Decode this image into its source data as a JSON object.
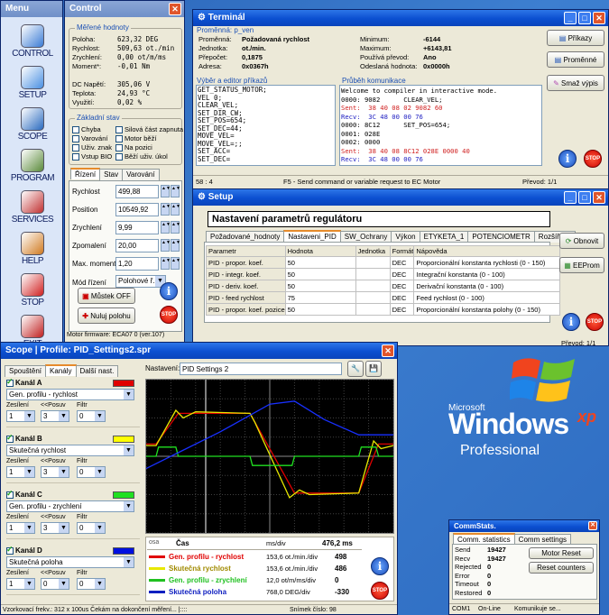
{
  "menu": {
    "title": "Menu",
    "items": [
      {
        "label": "CONTROL",
        "icon": "control-icon"
      },
      {
        "label": "SETUP",
        "icon": "setup-icon"
      },
      {
        "label": "SCOPE",
        "icon": "scope-icon"
      },
      {
        "label": "PROGRAM",
        "icon": "program-icon"
      },
      {
        "label": "SERVICES",
        "icon": "services-icon"
      },
      {
        "label": "HELP",
        "icon": "help-icon"
      },
      {
        "label": "STOP",
        "icon": "stop-icon"
      },
      {
        "label": "EXIT",
        "icon": "exit-icon"
      }
    ]
  },
  "control": {
    "title": "Control",
    "measured_title": "Měřené hodnoty",
    "measured": [
      {
        "label": "Poloha:",
        "value": "623,32 DEG"
      },
      {
        "label": "Rychlost:",
        "value": "509,63 ot./min"
      },
      {
        "label": "Zrychlení:",
        "value": "0,00 ot/m/ms"
      },
      {
        "label": "Moment*:",
        "value": "-0,01 Nm"
      }
    ],
    "measured2": [
      {
        "label": "DC Napětí:",
        "value": "305,06 V"
      },
      {
        "label": "Teplota:",
        "value": "24,93 °C"
      },
      {
        "label": "Využití:",
        "value": "0,02 %"
      }
    ],
    "status_title": "Základní stav",
    "status": [
      [
        "Chyba",
        "Silová část zapnuta"
      ],
      [
        "Varování",
        "Motor běží"
      ],
      [
        "Uživ. znak",
        "Na pozici"
      ],
      [
        "Vstup BIO",
        "Běží uživ. úkol"
      ]
    ],
    "tabs": [
      "Řízení",
      "Stav",
      "Varování"
    ],
    "params": [
      {
        "label": "Rychlost",
        "value": "499,88"
      },
      {
        "label": "Position",
        "value": "10549,92"
      },
      {
        "label": "Zrychlení",
        "value": "9,99"
      },
      {
        "label": "Zpomalení",
        "value": "20,00"
      },
      {
        "label": "Max. moment",
        "value": "1,20"
      }
    ],
    "mode_label": "Mód řízení",
    "mode_value": "Polohové ř.",
    "bridge_btn": "Můstek OFF",
    "zero_btn": "Nuluj polohu",
    "firmware": "Motor firmware: ECA07 0 (ver.107)"
  },
  "terminal": {
    "title": "Terminál",
    "var_title": "Proměnná: p_ven",
    "var_left": [
      {
        "label": "Proměnná:",
        "value": "Požadovaná rychlost"
      },
      {
        "label": "Jednotka:",
        "value": "ot./min."
      },
      {
        "label": "Přepočet:",
        "value": "0,1875"
      },
      {
        "label": "Adresa:",
        "value": "0x0367h"
      }
    ],
    "var_right": [
      {
        "label": "Minimum:",
        "value": "-6144"
      },
      {
        "label": "Maximum:",
        "value": "+6143,81"
      },
      {
        "label": "Používá převod:",
        "value": "Ano"
      },
      {
        "label": "Odeslaná hodnota:",
        "value": "0x0000h"
      }
    ],
    "cmd_title": "Výběr a editor příkazů",
    "commands": [
      "GET_STATUS_MOTOR;",
      "VEL 0;",
      "CLEAR_VEL;",
      "SET_DIR_CW;",
      "SET_POS=654;",
      "SET_DEC=44;",
      "MOVE_VEL=",
      "MOVE_VEL=;;",
      "SET_ACC=",
      "SET_DEC="
    ],
    "comm_title": "Průběh komunikace",
    "comm": [
      {
        "text": "Welcome to compiler in interactive mode.",
        "kind": "plain"
      },
      {
        "text": "0000: 9082      CLEAR_VEL;",
        "kind": "plain"
      },
      {
        "text": "Sent:  38 40 08 02 9082 60",
        "kind": "sent"
      },
      {
        "text": "Recv:  3C 48 00 00 76",
        "kind": "recv"
      },
      {
        "text": "0000: 8C12      SET_POS=654;",
        "kind": "plain"
      },
      {
        "text": "0001: 028E",
        "kind": "plain"
      },
      {
        "text": "0002: 0000",
        "kind": "plain"
      },
      {
        "text": "Sent:  38 40 08 8C12 028E 0000 40",
        "kind": "sent"
      },
      {
        "text": "Recv:  3C 48 00 00 76",
        "kind": "recv"
      }
    ],
    "buttons": [
      "Příkazy",
      "Proměnné",
      "Smaž výpis"
    ],
    "status_left": "58 : 4",
    "status_mid": "F5 - Send command or variable request to EC Motor",
    "status_right": "Převod: 1/1"
  },
  "setup": {
    "title": "Setup",
    "heading": "Nastavení parametrů regulátoru",
    "tabs": [
      "Požadované_hodnoty",
      "Nastaveni_PID",
      "SW_Ochrany",
      "Výkon",
      "ETYKETA_1",
      "POTENCIOMETR",
      "Rozšířené"
    ],
    "columns": [
      "Parametr",
      "Hodnota",
      "Jednotka",
      "Formát",
      "Nápověda"
    ],
    "rows": [
      [
        "PID - propor. koef.",
        "50",
        "",
        "DEC",
        "Proporcionální konstanta rychlosti (0 - 150)"
      ],
      [
        "PID - integr. koef.",
        "50",
        "",
        "DEC",
        "Integrační konstanta (0 - 100)"
      ],
      [
        "PID - deriv. koef.",
        "50",
        "",
        "DEC",
        "Derivační konstanta (0 - 100)"
      ],
      [
        "PID - feed rychlost",
        "75",
        "",
        "DEC",
        "Feed rychlost (0 - 100)"
      ],
      [
        "PID - propor. koef. pozice",
        "50",
        "",
        "DEC",
        "Proporcionální konstanta polohy (0 - 150)"
      ]
    ],
    "buttons": [
      "Obnovit",
      "EEProm"
    ],
    "status_right": "Převod: 1/1"
  },
  "scope": {
    "title": "Scope | Profile: PID_Settings2.spr",
    "tabs": [
      "Spouštění",
      "Kanály",
      "Další nast."
    ],
    "setting_label": "Nastavení:",
    "setting_value": "PID Settings 2",
    "channels": [
      {
        "name": "Kanál A",
        "signal": "Gen. profilu - rychlost",
        "color": "#e00000",
        "gain": "1",
        "shift": "3",
        "filter": "0"
      },
      {
        "name": "Kanál B",
        "signal": "Skutečná rychlost",
        "color": "#ffff00",
        "gain": "1",
        "shift": "3",
        "filter": "0"
      },
      {
        "name": "Kanál C",
        "signal": "Gen. profilu - zrychlení",
        "color": "#20e020",
        "gain": "1",
        "shift": "3",
        "filter": "0"
      },
      {
        "name": "Kanál D",
        "signal": "Skutečná poloha",
        "color": "#0010e0",
        "gain": "1",
        "shift": "0",
        "filter": "0"
      }
    ],
    "ch_labels": {
      "gain": "Zesílení",
      "shift": "<<Posuv",
      "filter": "Filtr"
    },
    "legend_header": {
      "axis": "osa",
      "time": "Čas",
      "unit": "ms/div",
      "value": "476,2 ms"
    },
    "legend": [
      {
        "name": "Gen. profilu - rychlost",
        "scale": "153,6 ot./min./div",
        "value": "498",
        "color": "#e00000"
      },
      {
        "name": "Skutečná rychlost",
        "scale": "153,6 ot./min./div",
        "value": "486",
        "color": "#e8e800"
      },
      {
        "name": "Gen. profilu - zrychlení",
        "scale": "12,0 ot/m/ms/div",
        "value": "0",
        "color": "#20c020"
      },
      {
        "name": "Skutečná poloha",
        "scale": "768,0 DEG/div",
        "value": "-330",
        "color": "#1020c0"
      }
    ],
    "status": "Vzorkovací frekv.: 312 x 100us    Čekám na dokončení měření... |::::",
    "frame": "Snímek číslo: 98"
  },
  "comm": {
    "title": "CommStats.",
    "tabs": [
      "Comm. statistics",
      "Comm settings"
    ],
    "stats": [
      {
        "label": "Send",
        "value": "19427"
      },
      {
        "label": "Recv",
        "value": "19427"
      },
      {
        "label": "Rejected",
        "value": "0"
      },
      {
        "label": "Error",
        "value": "0"
      },
      {
        "label": "Timeout",
        "value": "0"
      },
      {
        "label": "Restored",
        "value": "0"
      }
    ],
    "buttons": [
      "Motor Reset",
      "Reset counters"
    ],
    "status": [
      "COM1",
      "On-Line",
      "Komunikuje se..."
    ]
  },
  "windows_logo": {
    "brand": "Microsoft",
    "name": "Windows",
    "xp": "xp",
    "edition": "Professional"
  }
}
